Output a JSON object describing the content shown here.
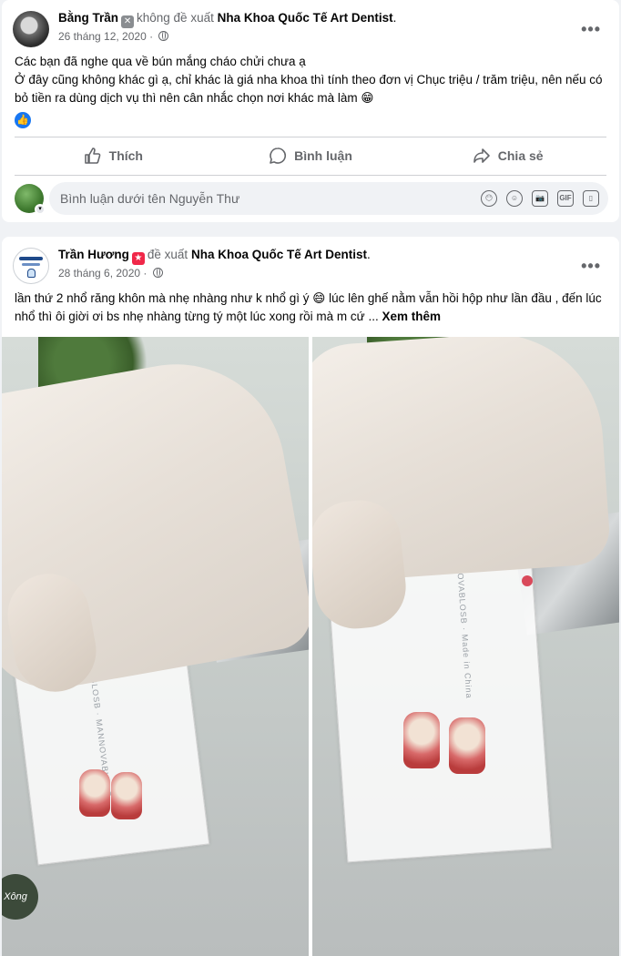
{
  "post1": {
    "author": "Bằng Trần",
    "recommend_text": "không đề xuất",
    "page": "Nha Khoa Quốc Tế Art Dentist",
    "punct": ".",
    "date": "26 tháng 12, 2020",
    "more": "•••",
    "line1": "Các bạn đã nghe qua về bún mắng cháo chửi chưa ạ",
    "line2": "Ở đây cũng không khác gì ạ, chỉ khác là giá nha khoa thì tính theo đơn vị Chục triệu / trăm triệu, nên nếu có bỏ tiền ra dùng dịch vụ thì nên cân nhắc chọn nơi khác mà làm 😁",
    "actions": {
      "like": "Thích",
      "comment": "Bình luận",
      "share": "Chia sẻ"
    },
    "comment_placeholder": "Bình luận dưới tên Nguyễn Thư",
    "comment_icons": [
      "😶",
      "☺",
      "📷",
      "GIF",
      "▯"
    ]
  },
  "post2": {
    "author": "Trần Hương",
    "recommend_text": "đề xuất",
    "page": "Nha Khoa Quốc Tế Art Dentist",
    "punct": ".",
    "date": "28 tháng 6, 2020",
    "more": "•••",
    "text": "lần thứ 2 nhổ răng khôn mà nhẹ nhàng như k nhổ gì ý 😄 lúc lên ghế nằm vẫn hồi hộp như lần đầu , đến lúc nhổ thì ôi giời ơi bs nhẹ nhàng từng tý một lúc xong rồi mà m cứ ...",
    "see_more": "Xem thêm",
    "sticker": "Xông"
  },
  "colors": {
    "accent": "#1877f2",
    "muted": "#65676b",
    "background": "#f0f2f5"
  }
}
